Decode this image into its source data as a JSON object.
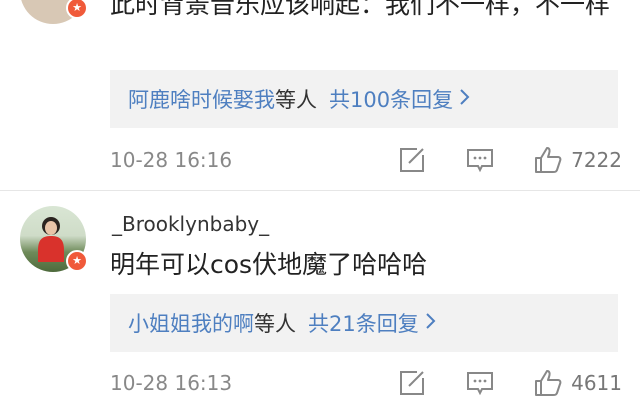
{
  "comments": [
    {
      "username": "",
      "text": "此时背景音乐应该响起：我们不一样，不一样",
      "reply": {
        "names": "阿鹿啥时候娶我",
        "suffix": "等人",
        "count": "共100条回复"
      },
      "time": "10-28 16:16",
      "likes": "7222"
    },
    {
      "username": "_Brooklynbaby_",
      "text": "明年可以cos伏地魔了哈哈哈",
      "reply": {
        "names": "小姐姐我的啊",
        "suffix": "等人",
        "count": "共21条回复"
      },
      "time": "10-28 16:13",
      "likes": "4611"
    }
  ],
  "icons": {
    "share": "share-icon",
    "comment": "comment-icon",
    "like": "thumbs-up-icon",
    "badge": "star-badge-icon"
  },
  "colors": {
    "link": "#4e7fc0",
    "badge": "#f05a3a",
    "reply_bg": "#f2f2f2"
  }
}
